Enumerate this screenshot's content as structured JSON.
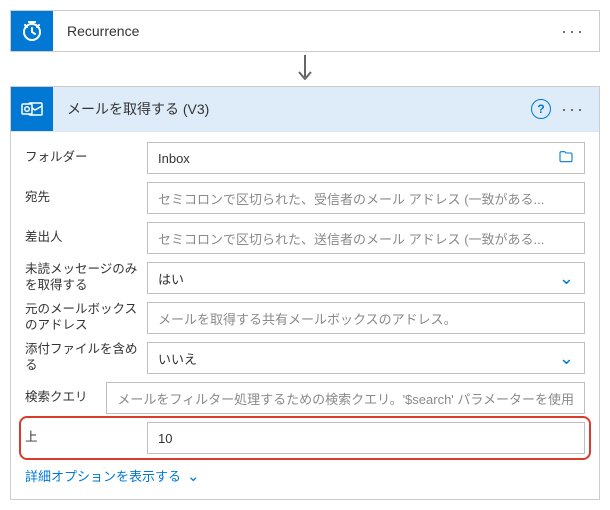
{
  "recurrence_card": {
    "title": "Recurrence"
  },
  "getmails_card": {
    "title": "メールを取得する (V3)"
  },
  "fields": {
    "folder_label": "フォルダー",
    "folder_value": "Inbox",
    "to_label": "宛先",
    "to_placeholder": "セミコロンで区切られた、受信者のメール アドレス (一致がある...",
    "from_label": "差出人",
    "from_placeholder": "セミコロンで区切られた、送信者のメール アドレス (一致がある...",
    "unread_label": "未読メッセージのみを取得する",
    "unread_value": "はい",
    "shared_label": "元のメールボックスのアドレス",
    "shared_placeholder": "メールを取得する共有メールボックスのアドレス。",
    "attach_label": "添付ファイルを含める",
    "attach_value": "いいえ",
    "search_label": "検索クエリ",
    "search_placeholder": "メールをフィルター処理するための検索クエリ。'$search' パラメーターを使用",
    "top_label": "上",
    "top_value": "10"
  },
  "footer": {
    "show_advanced": "詳細オプションを表示する"
  }
}
